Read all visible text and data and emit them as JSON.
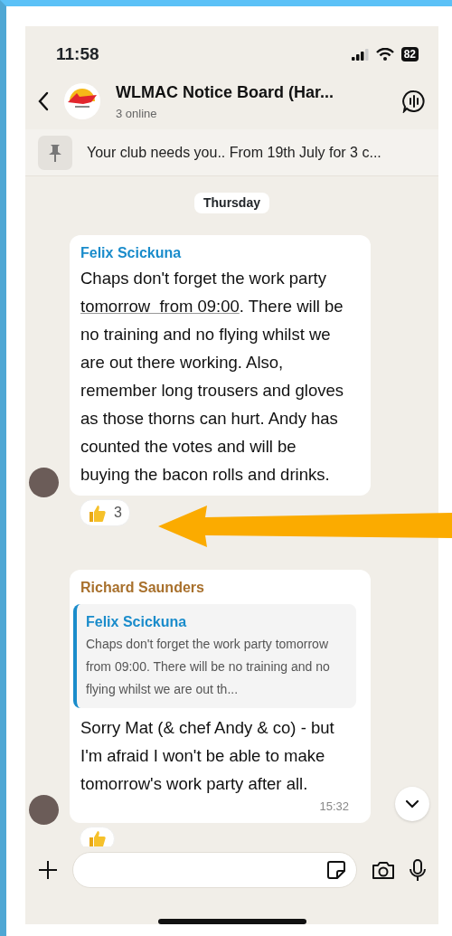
{
  "status_bar": {
    "time": "11:58",
    "battery": "82"
  },
  "header": {
    "title": "WLMAC Notice Board (Har...",
    "subtitle": "3 online"
  },
  "pinned": {
    "text": "Your club needs you.. From 19th July for 3 c..."
  },
  "date_chip": "Thursday",
  "messages": [
    {
      "sender": "Felix Scickuna",
      "color": "#1a8ccb",
      "body": [
        {
          "text": "Chaps don't forget the work party ",
          "underlined": false
        },
        {
          "text": "tomorrow  from 09:00",
          "underlined": true
        },
        {
          "text": ". There will be no training and no flying whilst we are out there working. Also, remember long trousers and gloves as those thorns can hurt. Andy has counted the votes and will be buying the bacon rolls and drinks.",
          "underlined": false
        }
      ],
      "reaction": {
        "kind": "thumbs-up",
        "count": "3"
      }
    },
    {
      "sender": "Richard Saunders",
      "color": "#a8702c",
      "quote": {
        "sender": "Felix Scickuna",
        "color": "#1a8ccb",
        "text": "Chaps don't forget the work party tomorrow  from 09:00. There will be no training and no flying whilst we are out th..."
      },
      "body": [
        {
          "text": "Sorry Mat (& chef Andy & co) - but I'm afraid I won't be able to make tomorrow's work party after all.",
          "underlined": false
        }
      ],
      "time": "15:32",
      "reaction": {
        "kind": "thumbs-up"
      }
    }
  ],
  "annotation": {
    "kind": "arrow"
  }
}
